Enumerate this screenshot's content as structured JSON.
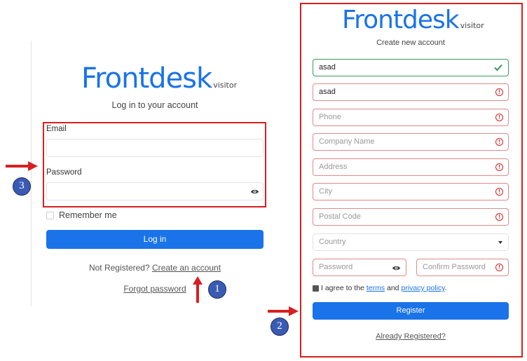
{
  "login": {
    "logo_main": "Frontdesk",
    "logo_sub": "visitor",
    "subtitle": "Log in to your account",
    "email_label": "Email",
    "email_value": "",
    "password_label": "Password",
    "password_value": "",
    "remember_label": "Remember me",
    "login_button": "Log in",
    "not_registered": "Not Registered?",
    "create_account_link": "Create an account",
    "forgot_password_link": "Forgot password"
  },
  "register": {
    "logo_main": "Frontdesk",
    "logo_sub": "visitor",
    "subtitle": "Create new account",
    "first_name_value": "asad",
    "last_name_value": "asad",
    "phone_placeholder": "Phone",
    "company_placeholder": "Company Name",
    "address_placeholder": "Address",
    "city_placeholder": "City",
    "postal_placeholder": "Postal Code",
    "country_placeholder": "Country",
    "password_placeholder": "Password",
    "confirm_password_placeholder": "Confirm Password",
    "agree_prefix": "I agree to the",
    "terms_link": "terms",
    "and_text": "and",
    "privacy_link": "privacy policy",
    "agree_suffix": ".",
    "register_button": "Register",
    "already_registered_link": "Already Registered?"
  },
  "annotations": {
    "badge_1": "1",
    "badge_2": "2",
    "badge_3": "3"
  },
  "colors": {
    "brand_blue": "#1a73e8",
    "highlight_red": "#d62020",
    "valid_green": "#3a9a5c",
    "badge_blue": "#3a5bb3"
  },
  "icons": [
    "eye-icon",
    "check-icon",
    "error-icon",
    "caret-down-icon",
    "arrow-right-icon",
    "arrow-up-icon"
  ]
}
